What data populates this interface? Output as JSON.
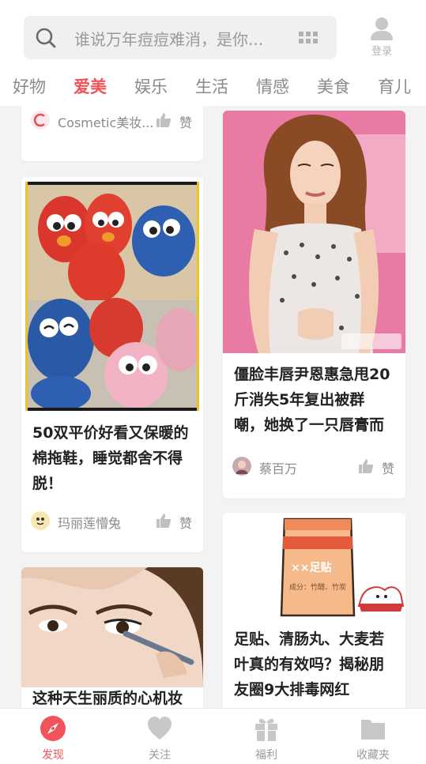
{
  "header": {
    "search_placeholder": "谁说万年痘痘难消，是你...",
    "login_label": "登录"
  },
  "tabs": [
    {
      "label": "好物",
      "active": false
    },
    {
      "label": "爱美",
      "active": true
    },
    {
      "label": "娱乐",
      "active": false
    },
    {
      "label": "生活",
      "active": false
    },
    {
      "label": "情感",
      "active": false
    },
    {
      "label": "美食",
      "active": false
    },
    {
      "label": "育儿",
      "active": false
    }
  ],
  "feed": {
    "left": [
      {
        "author": "Cosmetic美妆...",
        "like_label": "赞"
      },
      {
        "title": "50双平价好看又保暖的棉拖鞋，睡觉都舍不得脱！",
        "author": "玛丽莲懵兔",
        "like_label": "赞"
      },
      {
        "title": "这种天生丽质的心机妆"
      }
    ],
    "right": [
      {
        "title": "僵脸丰唇尹恩惠急甩20斤消失5年复出被群嘲，她换了一只唇膏而",
        "author": "蔡百万",
        "like_label": "赞"
      },
      {
        "title": "足贴、清肠丸、大麦若叶真的有效吗？揭秘朋友圈9大排毒网红",
        "product_label": "××足贴",
        "product_ingredients": "成分：竹醋、竹炭"
      }
    ]
  },
  "bottom_nav": [
    {
      "label": "发现",
      "icon": "compass-icon",
      "active": true
    },
    {
      "label": "关注",
      "icon": "heart-icon",
      "active": false
    },
    {
      "label": "福利",
      "icon": "gift-icon",
      "active": false
    },
    {
      "label": "收藏夹",
      "icon": "folder-icon",
      "active": false
    }
  ],
  "colors": {
    "accent": "#f0545a",
    "inactive": "#9a9a9a",
    "icon_gray": "#c8c8c8"
  }
}
